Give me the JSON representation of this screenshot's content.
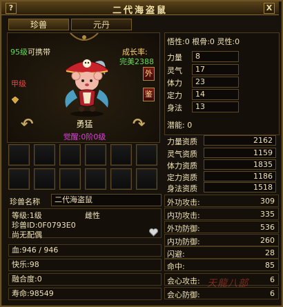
{
  "window": {
    "title": "二代海盗鼠",
    "help": "?",
    "close": "X"
  },
  "tabs": [
    {
      "label": "珍兽"
    },
    {
      "label": "元丹"
    }
  ],
  "pet": {
    "level_text": "95级",
    "carry_text": "可携带",
    "growth_label": "成长率:",
    "growth_value": "完美2388",
    "grade": "甲级",
    "btn_outer": "外",
    "btn_appraise": "鉴",
    "name": "勇猛",
    "awaken": "觉醒:0阶0级"
  },
  "info": {
    "name_label": "珍兽名称",
    "name_value": "二代海盗鼠",
    "level": "等级:1级",
    "gender": "雌性",
    "pet_id": "珍兽ID:0F0793E0",
    "mate": "尚无配偶",
    "hp": "血:946 / 946",
    "happy": "快乐:98",
    "fusion": "融合度:0",
    "life": "寿命:98549"
  },
  "stats": {
    "header": "悟性:0  根骨:0  灵性:0",
    "attributes": [
      {
        "label": "力量",
        "value": "8"
      },
      {
        "label": "灵气",
        "value": "17"
      },
      {
        "label": "体力",
        "value": "23"
      },
      {
        "label": "定力",
        "value": "14"
      },
      {
        "label": "身法",
        "value": "13"
      }
    ],
    "potential": "潜能: 0",
    "aptitudes": [
      {
        "label": "力量资质",
        "value": "2162"
      },
      {
        "label": "灵气资质",
        "value": "1159"
      },
      {
        "label": "体力资质",
        "value": "1835"
      },
      {
        "label": "定力资质",
        "value": "1186"
      },
      {
        "label": "身法资质",
        "value": "1518"
      }
    ],
    "combat": [
      {
        "label": "外功攻击:",
        "value": "309"
      },
      {
        "label": "内功攻击:",
        "value": "335"
      },
      {
        "label": "外功防御:",
        "value": "536"
      },
      {
        "label": "内功防御:",
        "value": "260"
      },
      {
        "label": "闪避:",
        "value": "28"
      },
      {
        "label": "命中:",
        "value": "85"
      },
      {
        "label": "会心攻击:",
        "value": "6"
      },
      {
        "label": "会心防御:",
        "value": "6"
      }
    ]
  },
  "logo": "天龍八部",
  "colors": {
    "border": "#6b5326",
    "green": "#66dd55",
    "red": "#ee4444",
    "purple": "#dd44dd"
  }
}
